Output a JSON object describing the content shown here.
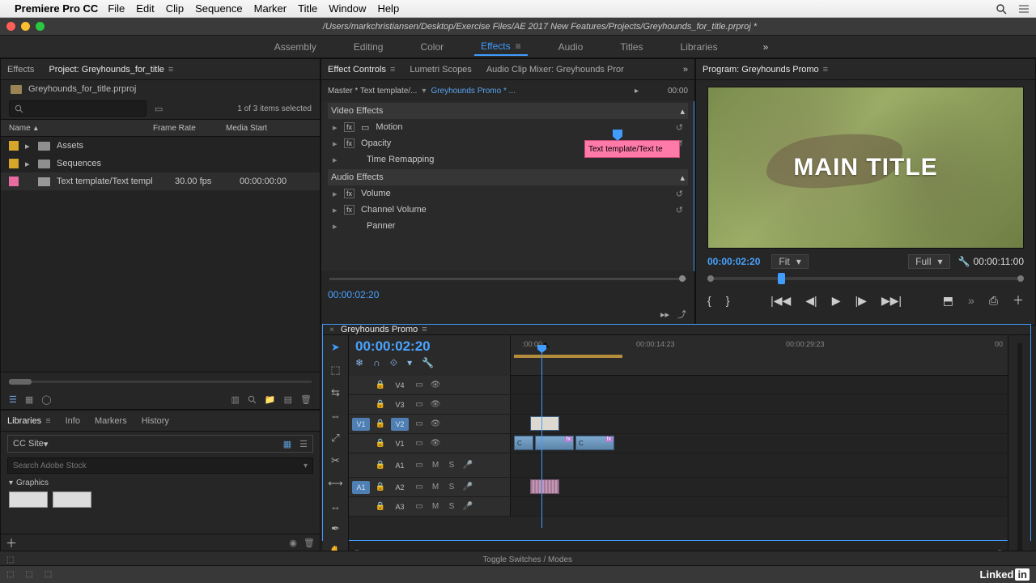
{
  "menubar": {
    "app": "Premiere Pro CC",
    "items": [
      "File",
      "Edit",
      "Clip",
      "Sequence",
      "Marker",
      "Title",
      "Window",
      "Help"
    ]
  },
  "titlebar": {
    "path": "/Users/markchristiansen/Desktop/Exercise Files/AE 2017 New Features/Projects/Greyhounds_for_title.prproj *"
  },
  "workspaces": {
    "items": [
      "Assembly",
      "Editing",
      "Color",
      "Effects",
      "Audio",
      "Titles",
      "Libraries"
    ],
    "active": "Effects",
    "overflow": "»"
  },
  "project_panel": {
    "tab_effects": "Effects",
    "tab_project": "Project: Greyhounds_for_title",
    "file_name": "Greyhounds_for_title.prproj",
    "search_placeholder": "",
    "item_count": "1 of 3 items selected",
    "cols": {
      "name": "Name",
      "frame_rate": "Frame Rate",
      "media_start": "Media Start"
    },
    "rows": [
      {
        "swatch": "#d6a52a",
        "name": "Assets",
        "fr": "",
        "ms": ""
      },
      {
        "swatch": "#d6a52a",
        "name": "Sequences",
        "fr": "",
        "ms": ""
      },
      {
        "swatch": "#e86ca1",
        "name": "Text template/Text templ",
        "fr": "30.00 fps",
        "ms": "00:00:00:00"
      }
    ]
  },
  "libraries": {
    "tabs": [
      "Libraries",
      "Info",
      "Markers",
      "History"
    ],
    "dropdown": "CC Site",
    "search_placeholder": "Search Adobe Stock",
    "section": "Graphics"
  },
  "effect_controls": {
    "tabs": [
      "Effect Controls",
      "Lumetri Scopes",
      "Audio Clip Mixer: Greyhounds Pror"
    ],
    "overflow": "»",
    "master": "Master * Text template/...",
    "sequence": "Greyhounds Promo * ...",
    "tc_end": "00:00",
    "clip_label": "Text template/Text te",
    "video_effects": "Video Effects",
    "audio_effects": "Audio Effects",
    "props_v": [
      "Motion",
      "Opacity",
      "Time Remapping"
    ],
    "props_a": [
      "Volume",
      "Channel Volume",
      "Panner"
    ],
    "timecode": "00:00:02:20"
  },
  "program": {
    "tab": "Program: Greyhounds Promo",
    "title_overlay": "MAIN TITLE",
    "tc": "00:00:02:20",
    "fit": "Fit",
    "full": "Full",
    "duration": "00:00:11:00"
  },
  "timeline": {
    "tab": "Greyhounds Promo",
    "tc": "00:00:02:20",
    "ruler": [
      ":00:00",
      "00:00:14:23",
      "00:00:29:23",
      "00"
    ],
    "tracks": {
      "v4": "V4",
      "v3": "V3",
      "v2": "V2",
      "v1": "V1",
      "a1": "A1",
      "a2": "A2",
      "a3": "A3",
      "src_v1": "V1",
      "src_a1": "A1"
    },
    "track_ctrl": {
      "m": "M",
      "s": "S"
    }
  },
  "statusbar": {
    "toggle": "Toggle Switches / Modes",
    "linkedin_text": "Linked",
    "linkedin_in": "in"
  }
}
